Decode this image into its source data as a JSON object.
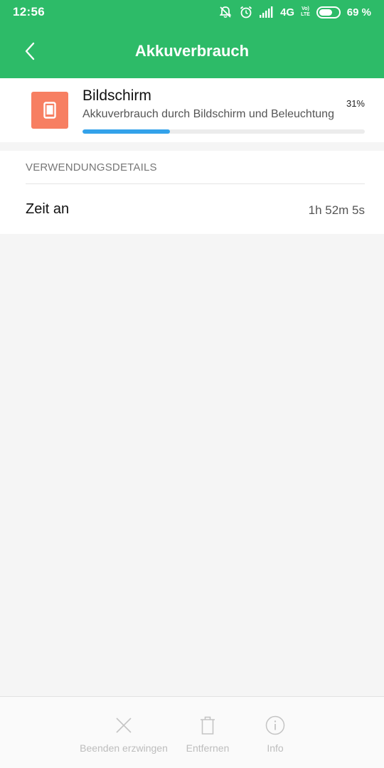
{
  "status_bar": {
    "time": "12:56",
    "network": "4G",
    "volte_top": "Vo)",
    "volte_bottom": "LTE",
    "battery_percent": "69 %",
    "battery_level": 0.69
  },
  "app_bar": {
    "title": "Akkuverbrauch"
  },
  "app": {
    "name": "Bildschirm",
    "description": "Akkuverbrauch durch Bildschirm und Beleuchtung",
    "percent_label": "31%",
    "usage_fraction": 0.31,
    "icon": "tablet-icon",
    "icon_color": "#f77f62"
  },
  "details": {
    "header": "VERWENDUNGSDETAILS",
    "rows": [
      {
        "label": "Zeit an",
        "value": "1h 52m 5s"
      }
    ]
  },
  "actions": {
    "force_stop": "Beenden erzwingen",
    "remove": "Entfernen",
    "info": "Info"
  },
  "colors": {
    "accent": "#2dbb68",
    "progress": "#33a2ea",
    "disabled": "#bdbdbd"
  }
}
